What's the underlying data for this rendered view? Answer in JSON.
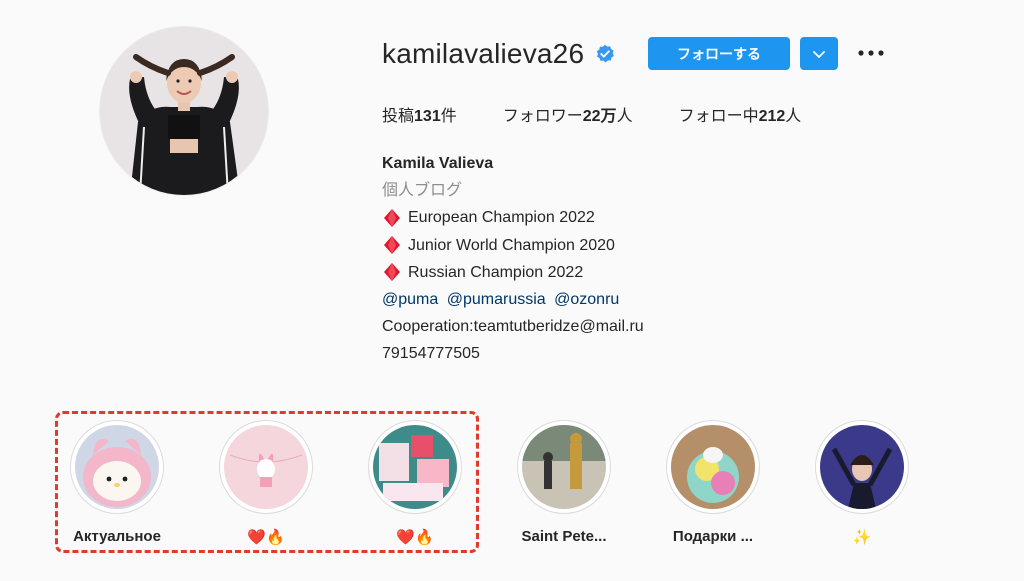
{
  "profile": {
    "username": "kamilavalieva26",
    "verified_icon": "verified-badge-icon",
    "follow_label": "フォローする",
    "stats": {
      "posts_prefix": "投稿",
      "posts_count": "131",
      "posts_suffix": "件",
      "followers_prefix": "フォロワー",
      "followers_count": "22万",
      "followers_suffix": "人",
      "following_prefix": "フォロー中",
      "following_count": "212",
      "following_suffix": "人"
    },
    "bio": {
      "name": "Kamila Valieva",
      "category": "個人ブログ",
      "lines": [
        "European Champion 2022",
        "Junior World Champion 2020",
        "Russian Champion 2022"
      ],
      "mentions": [
        "@puma",
        "@pumarussia",
        "@ozonru"
      ],
      "cooperation": "Cooperation:teamtutberidze@mail.ru",
      "phone": "79154777505"
    }
  },
  "highlights": [
    {
      "label": "Актуальное"
    },
    {
      "label": "❤️🔥"
    },
    {
      "label": "❤️🔥"
    },
    {
      "label": "Saint Pete..."
    },
    {
      "label": "Подарки ..."
    },
    {
      "label": "✨"
    }
  ],
  "colors": {
    "accent": "#1e96f0",
    "link": "#00376b",
    "highlight_box": "#e03a2a"
  }
}
